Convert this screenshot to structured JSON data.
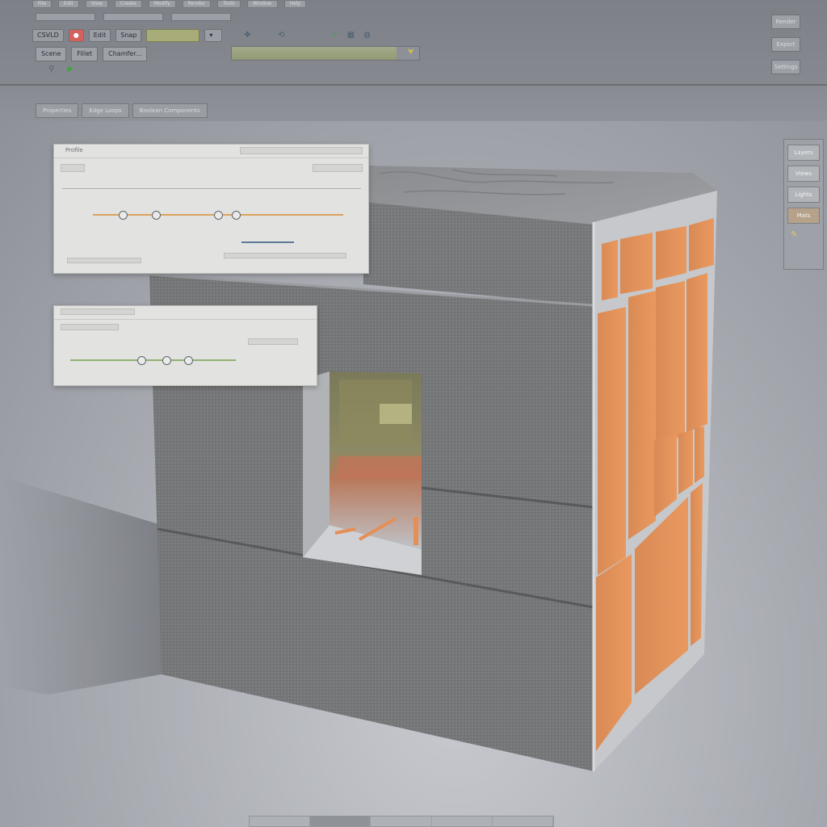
{
  "menu": {
    "items": [
      "File",
      "Edit",
      "View",
      "Create",
      "Modify",
      "Render",
      "Tools",
      "Window",
      "Help"
    ]
  },
  "toolbar": {
    "units_label": "CSVLD",
    "record_label": "●",
    "mode_label": "Edit",
    "snap_label": "Snap",
    "highlight_label": "",
    "icons": [
      "move-icon",
      "rotate-icon",
      "check-icon",
      "grid-icon",
      "globe-icon"
    ]
  },
  "tabs": [
    "Scene",
    "Fillet",
    "Chamfer..."
  ],
  "progress": {
    "value": 0.88,
    "label": ""
  },
  "sub_tabs": [
    "Properties",
    "Edge Loops",
    "Boolean Components"
  ],
  "right_buttons": [
    "Render",
    "Export",
    "Settings"
  ],
  "side_panel": {
    "items": [
      "Layers",
      "Views",
      "Lights",
      "Mats"
    ]
  },
  "dialog_top": {
    "title": "Profile",
    "subtitle": "",
    "knob_positions": [
      0.12,
      0.25,
      0.5,
      0.57
    ]
  },
  "dialog_bottom": {
    "title": "",
    "knob_positions": [
      0.43,
      0.58,
      0.71
    ]
  },
  "statusbar": {
    "items": [
      "",
      "",
      "",
      "",
      ""
    ]
  },
  "colors": {
    "accent_orange": "#e58f57",
    "concrete": "#7a7a7c",
    "dialog_bg": "#e2e2e0",
    "progress_fill": "#a3a98b",
    "record_red": "#d6605e"
  }
}
